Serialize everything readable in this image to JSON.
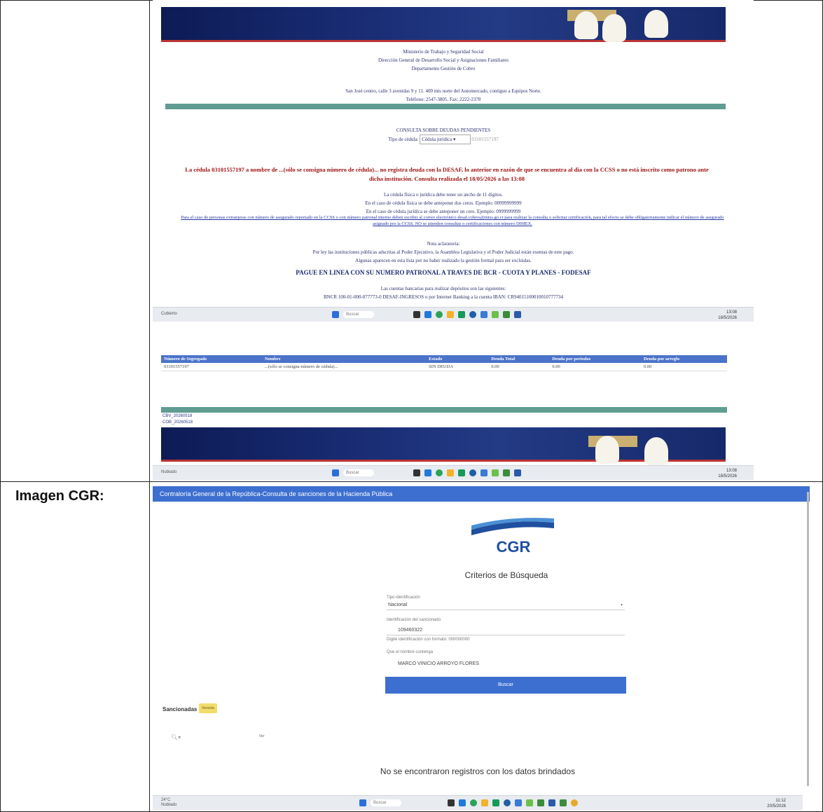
{
  "document": {
    "row_label": "Imagen CGR:"
  },
  "ccss": {
    "header_lines": [
      "Ministerio de Trabajo y Seguridad Social",
      "Dirección General de Desarrollo Social y Asignaciones Familiares",
      "Departamento Gestión de Cobro"
    ],
    "address_lines": [
      "San José centro, calle 3 avenidas 9 y 11. 400 mts norte del Automercado, contiguo a Equipos Norte.",
      "Teléfono: 2547-3805. Fax: 2222-2378"
    ],
    "query_title": "CONSULTA SOBRE DEUDAS PENDIENTES",
    "tipo_label": "Tipo de cédula:",
    "tipo_value": "Cédula jurídica",
    "cedula_value": "03101557197",
    "result_message": "La cédula 03101557197 a nombre de ...(sólo se consigna número de cédula)... no registra deuda con la DESAF, lo anterior en razón de que se encuentra al día con la CCSS o no está inscrito como patrono ante dicha institución. Consulta realizada el 18/05/2026 a las 13:08",
    "rules": [
      "La cédula física o jurídica debe tener un ancho de 11 dígitos.",
      "En el caso de cédula física se debe anteponer dos ceros. Ejemplo: 00999999999",
      "En el caso de cédula jurídica se debe anteponer un cero. Ejemplo: 0999999999"
    ],
    "extranjeros_note": "Para el caso de personas extranjeras con número de asegurado reportado en la CCSS o con número patronal interno deben escribir al correo electrónico desaf.cobros@mtss.go.cr para realizar la consulta o solicitar certificación, para tal efecto se debe obligatoriamente indicar el número de asegurado asignado por la CCSS. NO se atienden consultas o certificaciones con número DIMEX.",
    "nota_lines": [
      "Nota aclaratoria:",
      "Por ley las instituciones públicas adscritas al Poder Ejecutivo, la Asamblea Legislativa y el Poder Judicial están exentas de este pago.",
      "Algunas aparecen en esta lista por no haber realizado la gestión formal para ser excluidas."
    ],
    "pague": "PAGUE EN LINEA CON SU NUMERO PATRONAL A TRAVES DE BCR - CUOTA Y PLANES - FODESAF",
    "cuentas_lines": [
      "Las cuentas bancarias para realizar depósitos son las siguientes:",
      "BNCR 100-01-000-077773-0 DESAF-INGRESOS o por Internet Banking a la cuenta IBAN: CR94015100010010777734"
    ],
    "taskbar1": {
      "left": "Cubierto",
      "search": "Buscar",
      "time": "13:08",
      "date": "18/5/2026"
    },
    "table_headers": [
      "Número de Segregado",
      "Nombre",
      "Estado",
      "Deuda Total",
      "Deuda por periodos",
      "Deuda por arreglo"
    ],
    "table_row": [
      "03101557197",
      "...(sólo se consigna número de cédula)...",
      "SIN DEUDA",
      "0.00",
      "0.00",
      "0.00"
    ],
    "codes": [
      "CBV_20260518",
      "COB_20260518"
    ],
    "taskbar2": {
      "left": "Nublado",
      "search": "Buscar",
      "time": "13:08",
      "date": "18/5/2026"
    }
  },
  "cgr": {
    "header_title": "Contraloría General de la República-Consulta de sanciones de la Hacienda Pública",
    "logo_text": "CGR",
    "criteria_title": "Criterios de Búsqueda",
    "tipo_label": "Tipo identificación",
    "tipo_value": "Nacional",
    "id_label": "Identificación del sancionado",
    "id_value": "109460322",
    "id_hint": "Digite identificación con formato: 000000000",
    "name_label": "Que el nombre contenga",
    "name_value": "MARCO VINICIO ARROYO FLORES",
    "buscar_label": "Buscar",
    "sancionadas_label": "Sancionadas",
    "badge_label": "Vencida",
    "filter_value": "Ver",
    "no_records": "No se encontraron registros con los datos brindados",
    "taskbar": {
      "weather": "24°C",
      "weather_sub": "Nublado",
      "search": "Buscar",
      "time": "11:12",
      "date": "20/5/2026"
    }
  }
}
